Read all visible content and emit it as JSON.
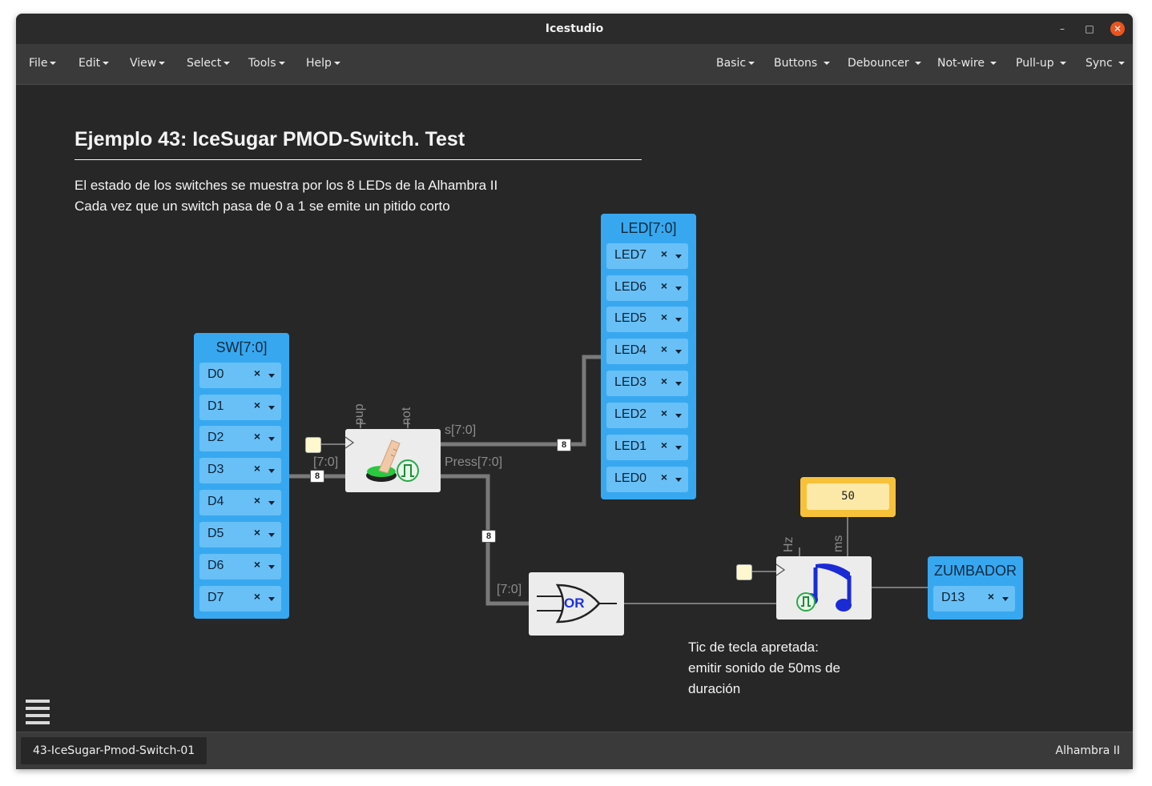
{
  "window": {
    "title": "Icestudio"
  },
  "menubar": {
    "left": [
      "File",
      "Edit",
      "View",
      "Select",
      "Tools",
      "Help"
    ],
    "right": [
      "Basic",
      "Buttons",
      "Debouncer",
      "Not-wire",
      "Pull-up",
      "Sync"
    ]
  },
  "canvas": {
    "heading": "Ejemplo 43: IceSugar PMOD-Switch. Test",
    "description_line1": "El estado de los switches se muestra por los 8 LEDs de la Alhambra II",
    "description_line2": "Cada vez que un switch pasa de 0 a 1 se emite un pitido corto",
    "sw_block": {
      "title": "SW[7:0]",
      "pins": [
        "D0",
        "D1",
        "D2",
        "D3",
        "D4",
        "D5",
        "D6",
        "D7"
      ]
    },
    "led_block": {
      "title": "LED[7:0]",
      "pins": [
        "LED7",
        "LED6",
        "LED5",
        "LED4",
        "LED3",
        "LED2",
        "LED1",
        "LED0"
      ]
    },
    "buzzer_block": {
      "title": "ZUMBADOR",
      "pins": [
        "D13"
      ]
    },
    "pin_remove_symbol": "×",
    "button_block": {
      "in_label": "[7:0]",
      "out_s": "s[7:0]",
      "out_press": "Press[7:0]",
      "param_pup": "pup",
      "param_not": "not"
    },
    "or_block": {
      "in_label": "[7:0]",
      "gate_text": "OR"
    },
    "sound_block": {
      "param_hz": "Hz",
      "param_ms": "ms"
    },
    "constant": {
      "value": "50"
    },
    "bus_badges": [
      "8",
      "8",
      "8"
    ],
    "note_line1": "Tic de tecla apretada:",
    "note_line2": "emitir sonido de 50ms de",
    "note_line3": "duración"
  },
  "statusbar": {
    "file_tab": "43-IceSugar-Pmod-Switch-01",
    "board": "Alhambra II"
  },
  "colors": {
    "port_blue": "#37a8f0",
    "pin_blue": "#68c0f6",
    "constant_yellow": "#f7c23a",
    "close_orange": "#e95420"
  }
}
